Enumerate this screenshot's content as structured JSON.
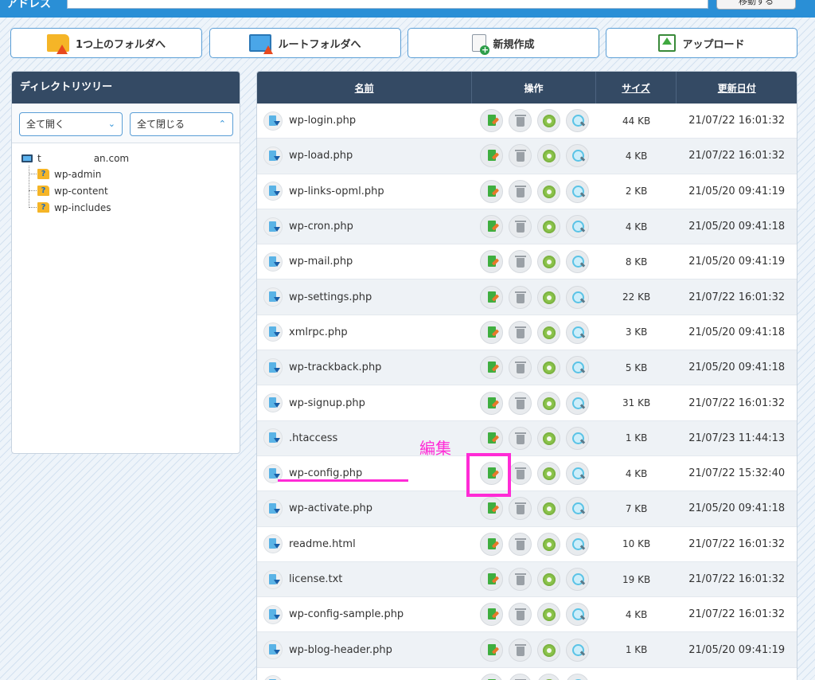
{
  "address": {
    "label": "アドレス",
    "go_label": "移動する"
  },
  "toolbar": [
    {
      "label": "1つ上のフォルダへ",
      "icon": "folder-up-icon"
    },
    {
      "label": "ルートフォルダへ",
      "icon": "root-folder-icon"
    },
    {
      "label": "新規作成",
      "icon": "new-file-icon"
    },
    {
      "label": "アップロード",
      "icon": "upload-icon"
    }
  ],
  "tree": {
    "title": "ディレクトリツリー",
    "expand_all": "全て開く",
    "collapse_all": "全て閉じる",
    "root": "t           an.com",
    "children": [
      "wp-admin",
      "wp-content",
      "wp-includes"
    ]
  },
  "table": {
    "headers": {
      "name": "名前",
      "ops": "操作",
      "size": "サイズ",
      "date": "更新日付"
    },
    "rows": [
      {
        "name": "wp-login.php",
        "size": "44 KB",
        "date": "21/07/22 16:01:32"
      },
      {
        "name": "wp-load.php",
        "size": "4 KB",
        "date": "21/07/22 16:01:32"
      },
      {
        "name": "wp-links-opml.php",
        "size": "2 KB",
        "date": "21/05/20 09:41:19"
      },
      {
        "name": "wp-cron.php",
        "size": "4 KB",
        "date": "21/05/20 09:41:18"
      },
      {
        "name": "wp-mail.php",
        "size": "8 KB",
        "date": "21/05/20 09:41:19"
      },
      {
        "name": "wp-settings.php",
        "size": "22 KB",
        "date": "21/07/22 16:01:32"
      },
      {
        "name": "xmlrpc.php",
        "size": "3 KB",
        "date": "21/05/20 09:41:18"
      },
      {
        "name": "wp-trackback.php",
        "size": "5 KB",
        "date": "21/05/20 09:41:18"
      },
      {
        "name": "wp-signup.php",
        "size": "31 KB",
        "date": "21/07/22 16:01:32"
      },
      {
        "name": ".htaccess",
        "size": "1 KB",
        "date": "21/07/23 11:44:13"
      },
      {
        "name": "wp-config.php",
        "size": "4 KB",
        "date": "21/07/22 15:32:40"
      },
      {
        "name": "wp-activate.php",
        "size": "7 KB",
        "date": "21/05/20 09:41:18"
      },
      {
        "name": "readme.html",
        "size": "10 KB",
        "date": "21/07/22 16:01:32"
      },
      {
        "name": "license.txt",
        "size": "19 KB",
        "date": "21/07/22 16:01:32"
      },
      {
        "name": "wp-config-sample.php",
        "size": "4 KB",
        "date": "21/07/22 16:01:32"
      },
      {
        "name": "wp-blog-header.php",
        "size": "1 KB",
        "date": "21/05/20 09:41:19"
      },
      {
        "name": "",
        "size": "",
        "date": ""
      }
    ]
  },
  "annotation": {
    "label": "編集",
    "color": "#ff2bd6"
  },
  "colors": {
    "header_bg": "#344a64",
    "accent": "#2a8fd6"
  }
}
